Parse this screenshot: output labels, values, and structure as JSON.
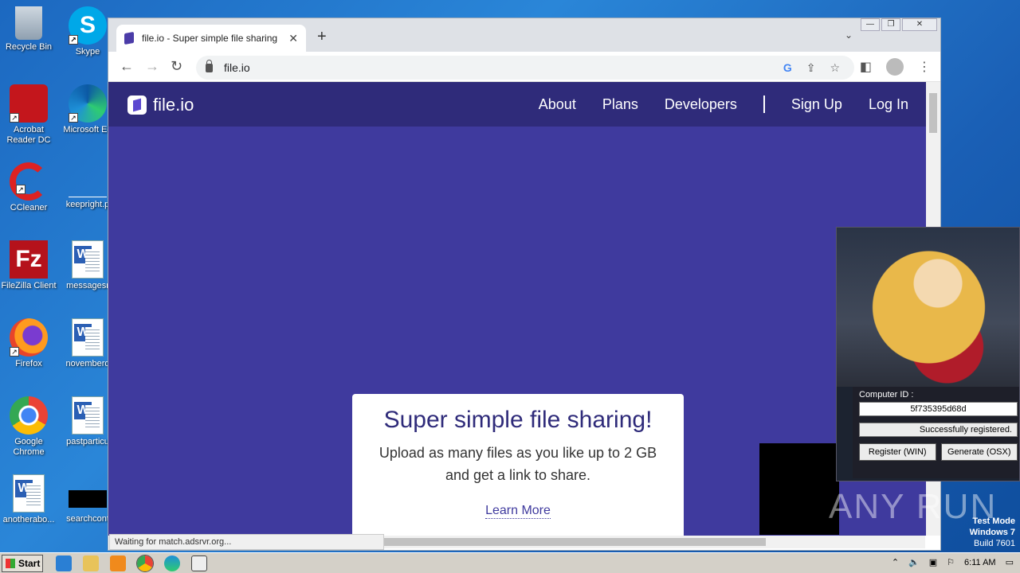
{
  "desktop": {
    "icons_left": [
      {
        "label": "Recycle Bin"
      },
      {
        "label": "Acrobat Reader DC"
      },
      {
        "label": "CCleaner"
      },
      {
        "label": "FileZilla Client"
      },
      {
        "label": "Firefox"
      },
      {
        "label": "Google Chrome"
      },
      {
        "label": "anotherabo..."
      }
    ],
    "icons_right": [
      {
        "label": "Skype"
      },
      {
        "label": "Microsoft Ed"
      },
      {
        "label": "keepright.p"
      },
      {
        "label": "messagesr"
      },
      {
        "label": "novemberd"
      },
      {
        "label": "pastparticu"
      },
      {
        "label": "searchcont"
      }
    ]
  },
  "browser": {
    "tab_title": "file.io - Super simple file sharing",
    "url": "file.io",
    "status_text": "Waiting for match.adsrvr.org..."
  },
  "site": {
    "logo_text": "file.io",
    "nav": [
      "About",
      "Plans",
      "Developers",
      "Sign Up",
      "Log In"
    ],
    "headline": "Super simple file sharing!",
    "subtext": "Upload as many files as you like up to 2 GB and get a link to share.",
    "learn_more": "Learn More"
  },
  "keygen": {
    "computer_id_label": "Computer ID :",
    "computer_id": "5f735395d68d",
    "status": "Successfully registered.",
    "register_btn": "Register (WIN)",
    "generate_btn": "Generate (OSX)"
  },
  "overlay": {
    "watermark": "ANY RUN",
    "test_mode": "Test Mode",
    "os": "Windows 7",
    "build": "Build 7601"
  },
  "taskbar": {
    "start": "Start",
    "clock": "6:11 AM"
  }
}
